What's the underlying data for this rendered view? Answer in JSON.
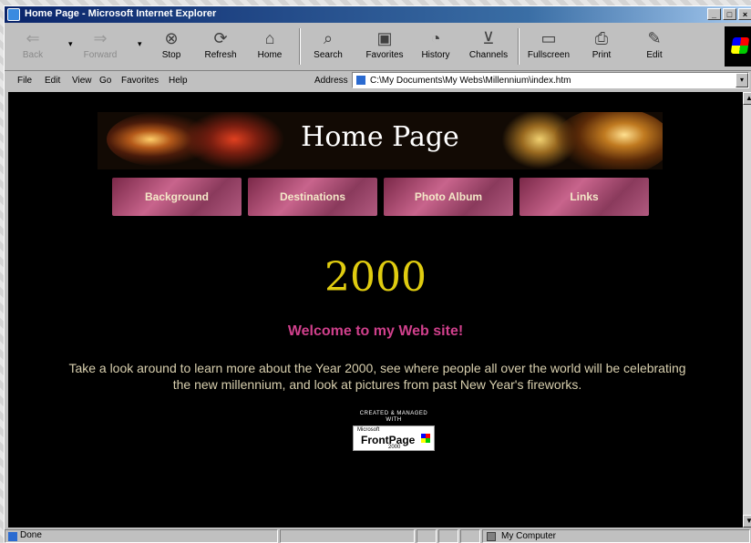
{
  "window": {
    "title": "Home Page - Microsoft Internet Explorer",
    "controls": {
      "minimize": "_",
      "maximize": "□",
      "close": "×"
    }
  },
  "toolbar": {
    "buttons": [
      {
        "label": "Back",
        "icon": "back-arrow-icon",
        "glyph": "⇐",
        "enabled": false
      },
      {
        "label": "Forward",
        "icon": "forward-arrow-icon",
        "glyph": "⇒",
        "enabled": false
      },
      {
        "label": "Stop",
        "icon": "stop-icon",
        "glyph": "⊗",
        "enabled": true
      },
      {
        "label": "Refresh",
        "icon": "refresh-icon",
        "glyph": "⟳",
        "enabled": true
      },
      {
        "label": "Home",
        "icon": "home-icon",
        "glyph": "⌂",
        "enabled": true
      },
      {
        "label": "Search",
        "icon": "search-icon",
        "glyph": "⌕",
        "enabled": true
      },
      {
        "label": "Favorites",
        "icon": "favorites-icon",
        "glyph": "▣",
        "enabled": true
      },
      {
        "label": "History",
        "icon": "history-icon",
        "glyph": "◔",
        "enabled": true
      },
      {
        "label": "Channels",
        "icon": "channels-icon",
        "glyph": "⊻",
        "enabled": true
      },
      {
        "label": "Fullscreen",
        "icon": "fullscreen-icon",
        "glyph": "▭",
        "enabled": true
      },
      {
        "label": "Print",
        "icon": "print-icon",
        "glyph": "⎙",
        "enabled": true
      },
      {
        "label": "Edit",
        "icon": "edit-icon",
        "glyph": "✎",
        "enabled": true
      }
    ],
    "dropdown_glyph": "▾"
  },
  "menu": {
    "items": [
      "File",
      "Edit",
      "View",
      "Go",
      "Favorites",
      "Help"
    ]
  },
  "address": {
    "label": "Address",
    "value": "C:\\My Documents\\My Webs\\Millennium\\index.htm",
    "dropdown_glyph": "▾"
  },
  "page": {
    "banner_title": "Home Page",
    "nav": [
      "Background",
      "Destinations",
      "Photo Album",
      "Links"
    ],
    "year": "2000",
    "welcome": "Welcome to my Web site!",
    "paragraph": "Take a look around to learn more about the Year 2000, see where people all over the world will be celebrating the new millennium, and look at pictures from past New Year's fireworks.",
    "badge": {
      "caption_line1": "CREATED & MANAGED",
      "caption_line2": "WITH",
      "microsoft": "Microsoft",
      "product": "FrontPage",
      "version": "2000"
    }
  },
  "scrollbar": {
    "up": "▲",
    "down": "▼"
  },
  "status": {
    "text": "Done",
    "zone": "My Computer"
  },
  "colors": {
    "year": "#e0cc10",
    "welcome": "#d0408c",
    "paragraph": "#d8cfae",
    "title_bar": "#0a246a"
  }
}
